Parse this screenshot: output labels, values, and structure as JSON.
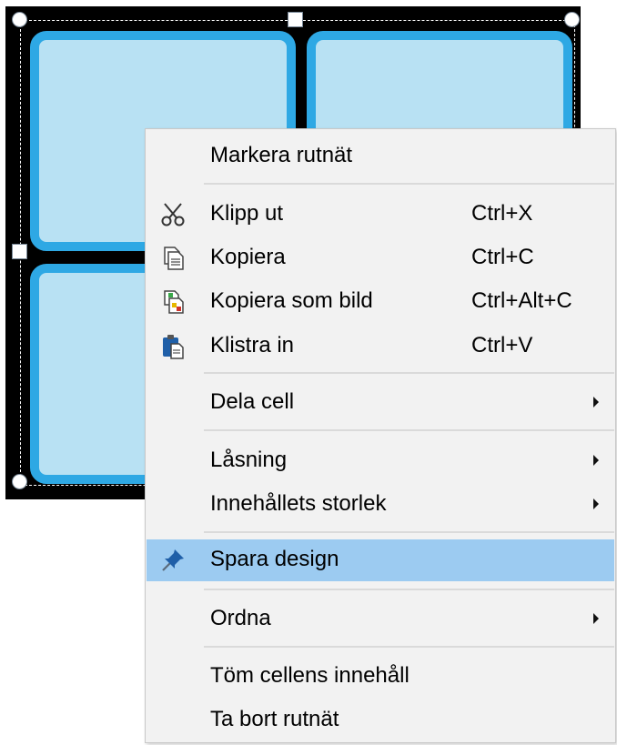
{
  "grid": {
    "cells": [
      "cell-top-left",
      "cell-top-right",
      "cell-bottom-left",
      "cell-bottom-right"
    ],
    "colors": {
      "background": "#000000",
      "cell_fill": "#b8e1f3",
      "cell_border": "#2ea8e4"
    }
  },
  "menu": {
    "highlight_color": "#9ccbf1",
    "items": [
      {
        "label": "Markera rutnät",
        "shortcut": "",
        "icon": "",
        "submenu": false
      },
      {
        "label": "Klipp ut",
        "shortcut": "Ctrl+X",
        "icon": "scissors-icon",
        "submenu": false
      },
      {
        "label": "Kopiera",
        "shortcut": "Ctrl+C",
        "icon": "copy-icon",
        "submenu": false
      },
      {
        "label": "Kopiera som bild",
        "shortcut": "Ctrl+Alt+C",
        "icon": "copy-as-image-icon",
        "submenu": false
      },
      {
        "label": "Klistra in",
        "shortcut": "Ctrl+V",
        "icon": "paste-icon",
        "submenu": false
      },
      {
        "label": "Dela cell",
        "shortcut": "",
        "icon": "",
        "submenu": true
      },
      {
        "label": "Låsning",
        "shortcut": "",
        "icon": "",
        "submenu": true
      },
      {
        "label": "Innehållets storlek",
        "shortcut": "",
        "icon": "",
        "submenu": true
      },
      {
        "label": "Spara design",
        "shortcut": "",
        "icon": "pin-icon",
        "submenu": false,
        "highlighted": true
      },
      {
        "label": "Ordna",
        "shortcut": "",
        "icon": "",
        "submenu": true
      },
      {
        "label": "Töm cellens innehåll",
        "shortcut": "",
        "icon": "",
        "submenu": false
      },
      {
        "label": "Ta bort rutnät",
        "shortcut": "",
        "icon": "",
        "submenu": false
      }
    ]
  }
}
